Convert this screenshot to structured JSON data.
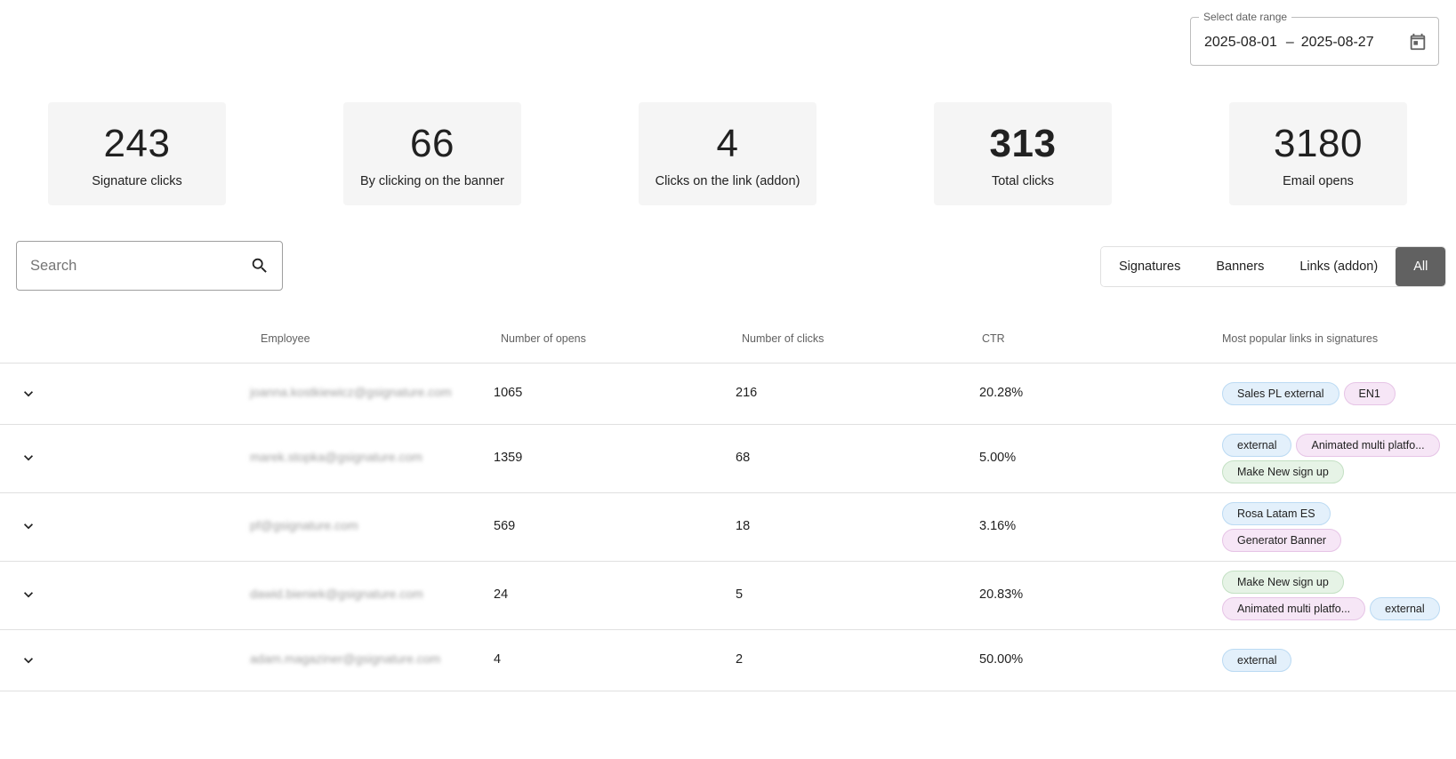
{
  "date_range": {
    "label": "Select date range",
    "start": "2025-08-01",
    "separator": "–",
    "end": "2025-08-27"
  },
  "stats": [
    {
      "value": "243",
      "label": "Signature clicks"
    },
    {
      "value": "66",
      "label": "By clicking on the banner"
    },
    {
      "value": "4",
      "label": "Clicks on the link (addon)"
    },
    {
      "value": "313",
      "label": "Total clicks"
    },
    {
      "value": "3180",
      "label": "Email opens"
    }
  ],
  "search": {
    "placeholder": "Search",
    "icon": "search-icon"
  },
  "filters": {
    "options": [
      "Signatures",
      "Banners",
      "Links (addon)",
      "All"
    ],
    "selected": "All"
  },
  "table": {
    "headers": [
      "Employee",
      "Number of opens",
      "Number of clicks",
      "CTR",
      "Most popular links in signatures"
    ],
    "rows": [
      {
        "employee": "joanna.kostkiewicz@gsignature.com",
        "opens": "1065",
        "clicks": "216",
        "ctr": "20.28%",
        "links": [
          {
            "label": "Sales PL external",
            "color": "blue"
          },
          {
            "label": "EN1",
            "color": "pink"
          }
        ]
      },
      {
        "employee": "marek.stopka@gsignature.com",
        "opens": "1359",
        "clicks": "68",
        "ctr": "5.00%",
        "links": [
          {
            "label": "external",
            "color": "blue"
          },
          {
            "label": "Animated multi platfo...",
            "color": "pink"
          },
          {
            "label": "Make New sign up",
            "color": "green"
          }
        ]
      },
      {
        "employee": "pf@gsignature.com",
        "opens": "569",
        "clicks": "18",
        "ctr": "3.16%",
        "links": [
          {
            "label": "Rosa Latam ES",
            "color": "blue"
          },
          {
            "label": "Generator Banner",
            "color": "pink"
          }
        ]
      },
      {
        "employee": "dawid.bieniek@gsignature.com",
        "opens": "24",
        "clicks": "5",
        "ctr": "20.83%",
        "links": [
          {
            "label": "Make New sign up",
            "color": "green"
          },
          {
            "label": "Animated multi platfo...",
            "color": "pink"
          },
          {
            "label": "external",
            "color": "blue"
          }
        ]
      },
      {
        "employee": "adam.magaziner@gsignature.com",
        "opens": "4",
        "clicks": "2",
        "ctr": "50.00%",
        "links": [
          {
            "label": "external",
            "color": "blue"
          }
        ]
      }
    ]
  },
  "colors": {
    "active_filter": "#616161",
    "chip_blue": "#e3f0fb",
    "chip_pink": "#f6e6f6",
    "chip_green": "#e6f3e6"
  }
}
